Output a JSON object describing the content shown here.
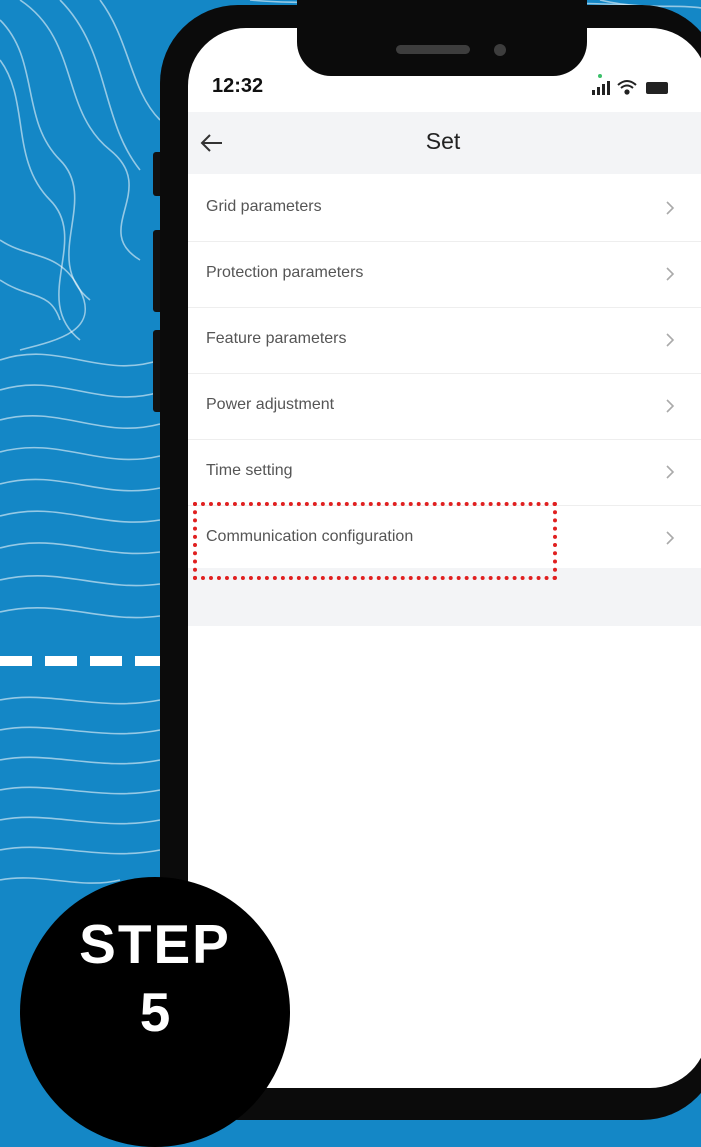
{
  "colors": {
    "background": "#1487c6",
    "phone_frame": "#0b0b0b",
    "header_bg": "#f3f4f6",
    "highlight": "#e02020"
  },
  "status_bar": {
    "time": "12:32",
    "icons": [
      "signal-icon",
      "wifi-icon",
      "battery-icon"
    ]
  },
  "header": {
    "back_icon": "back-arrow-icon",
    "title": "Set"
  },
  "settings": {
    "items": [
      {
        "label": "Grid parameters"
      },
      {
        "label": "Protection parameters"
      },
      {
        "label": "Feature parameters"
      },
      {
        "label": "Power adjustment"
      },
      {
        "label": "Time setting"
      },
      {
        "label": "Communication configuration"
      }
    ],
    "chevron_icon": "chevron-right-icon"
  },
  "highlighted_item": "Communication configuration",
  "step": {
    "word": "STEP",
    "number": "5"
  }
}
